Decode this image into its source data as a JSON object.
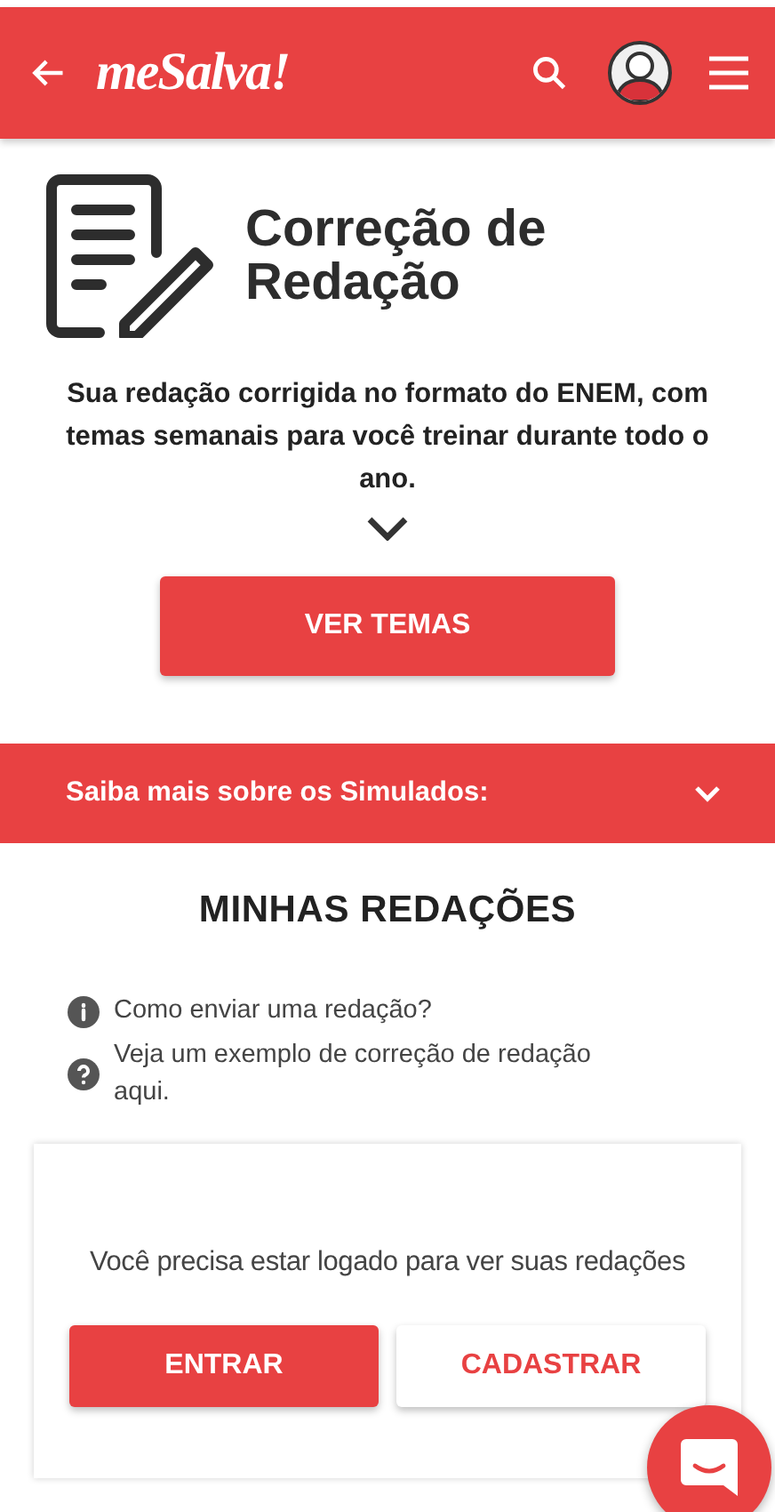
{
  "header": {
    "logo": "meSalva!"
  },
  "hero": {
    "title": "Correção de Redação",
    "description": "Sua redação corrigida no formato do ENEM, com temas semanais para você treinar durante todo o ano.",
    "button": "VER TEMAS"
  },
  "banner": {
    "label": "Saiba mais sobre os Simulados:",
    "expanded": false
  },
  "section": {
    "title": "MINHAS REDAÇÕES",
    "links": [
      {
        "kind": "info",
        "text": "Como enviar uma redação?"
      },
      {
        "kind": "help",
        "text": "Veja um exemplo de correção de redação aqui."
      }
    ]
  },
  "login_card": {
    "message": "Você precisa estar logado para ver suas redações",
    "buttons": [
      {
        "kind": "primary",
        "label": "ENTRAR"
      },
      {
        "kind": "secondary",
        "label": "CADASTRAR"
      }
    ]
  }
}
